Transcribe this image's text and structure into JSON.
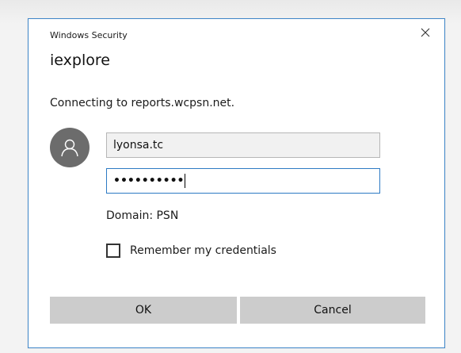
{
  "dialog": {
    "caption": "Windows Security",
    "app_title": "iexplore",
    "message": "Connecting to reports.wcpsn.net.",
    "close_icon": "close-icon",
    "avatar_icon": "user-icon"
  },
  "form": {
    "username_value": "lyonsa.tc",
    "password_masked": "••••••••••",
    "domain_text": "Domain: PSN",
    "remember_label": "Remember my credentials",
    "remember_checked": false
  },
  "buttons": {
    "ok_label": "OK",
    "cancel_label": "Cancel"
  },
  "colors": {
    "accent_border": "#3f86c8",
    "avatar_bg": "#6c6c6c",
    "button_bg": "#cccccc"
  }
}
